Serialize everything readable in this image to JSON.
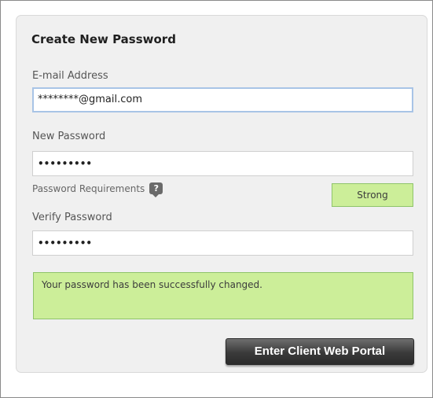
{
  "form": {
    "title": "Create New Password",
    "email_label": "E-mail Address",
    "email_value": "********@gmail.com",
    "new_password_label": "New Password",
    "new_password_value": "•••••••••",
    "requirements_label": "Password Requirements",
    "requirements_icon": "?",
    "strength_text": "Strong",
    "verify_password_label": "Verify Password",
    "verify_password_value": "•••••••••",
    "success_message": "Your password has been successfully changed.",
    "submit_label": "Enter Client Web Portal"
  },
  "colors": {
    "success_bg": "#ccee99",
    "success_border": "#8fc46a",
    "focus_border": "#a8c4e6",
    "button_dark": "#3a3a3a"
  },
  "icons": {
    "help": "help-icon"
  }
}
